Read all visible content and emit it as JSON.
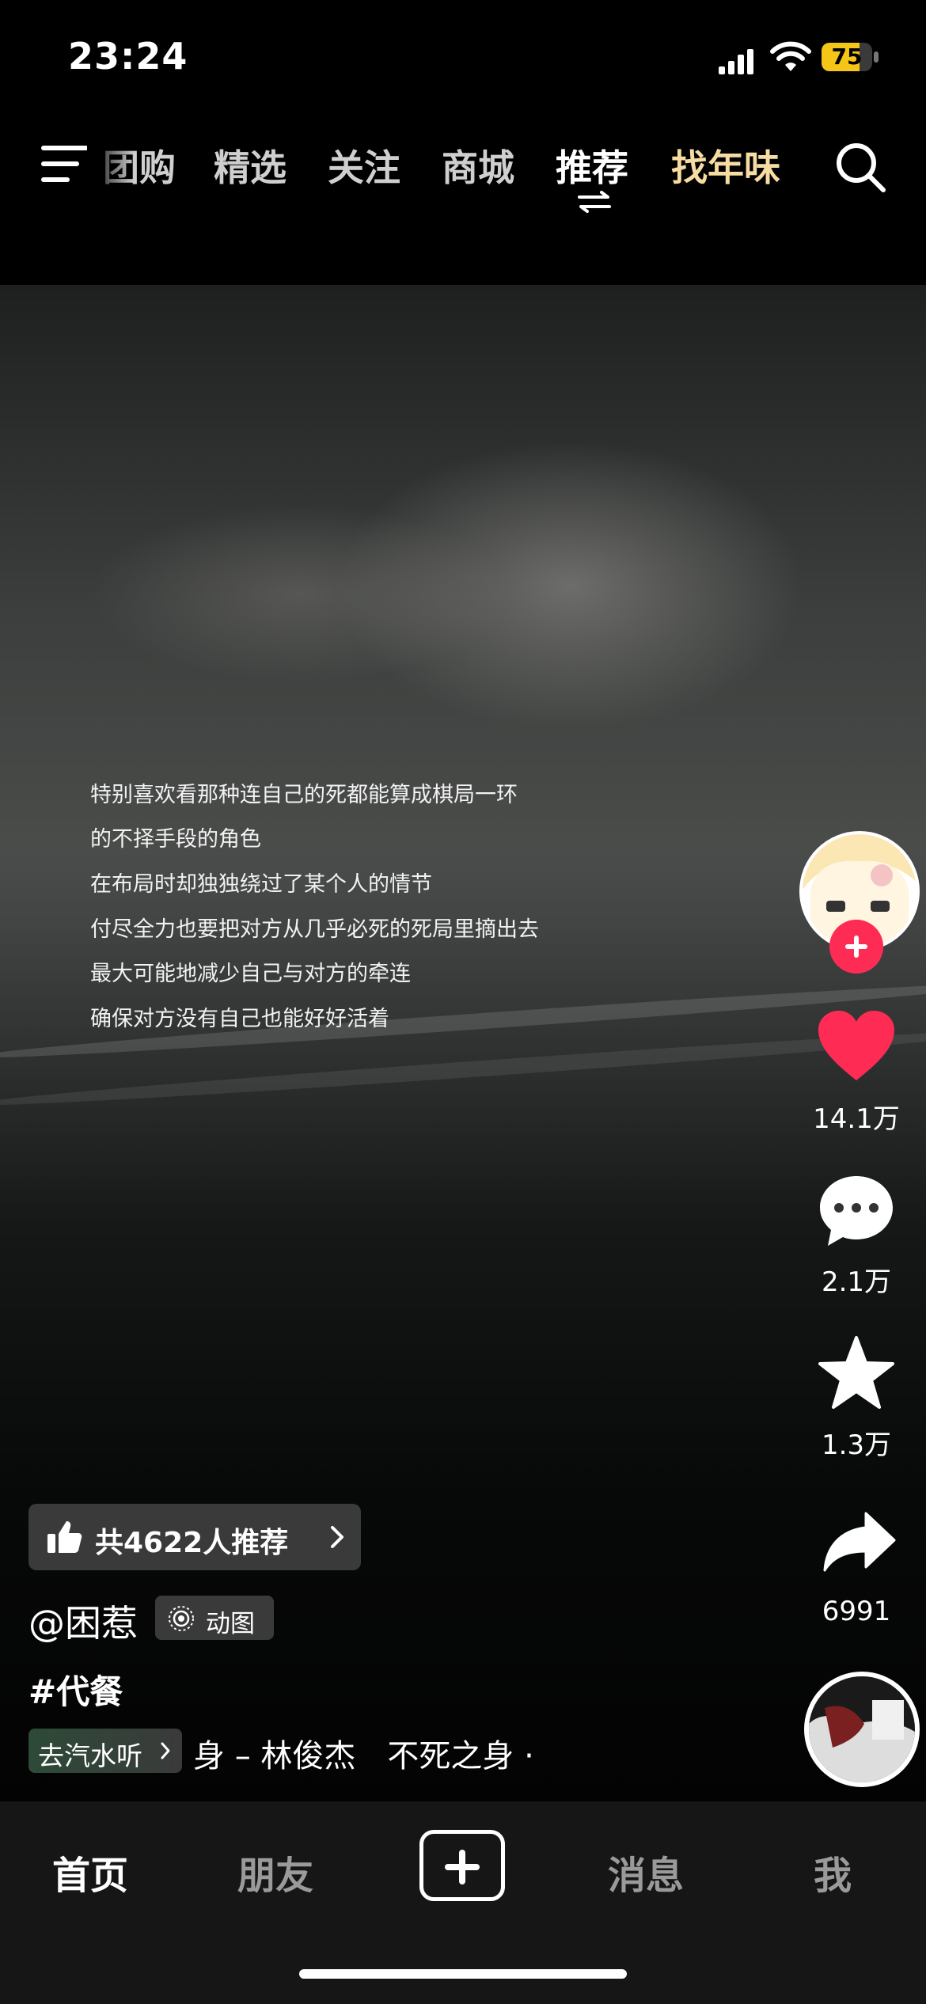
{
  "status_bar": {
    "time": "23:24",
    "battery_level": "75",
    "battery_fraction": 0.75
  },
  "top_nav": {
    "tabs": [
      {
        "label": "团购"
      },
      {
        "label": "精选"
      },
      {
        "label": "关注"
      },
      {
        "label": "商城"
      },
      {
        "label": "推荐"
      },
      {
        "label": "找年味"
      }
    ],
    "active_tab": "推荐"
  },
  "video": {
    "lyrics": [
      "特别喜欢看那种连自己的死都能算成棋局一环",
      "的不择手段的角色",
      "在布局时却独独绕过了某个人的情节",
      "付尽全力也要把对方从几乎必死的死局里摘出去",
      "最大可能地减少自己与对方的牵连",
      "确保对方没有自己也能好好活着"
    ]
  },
  "actions": {
    "likes": "14.1万",
    "comments": "2.1万",
    "favorites": "1.3万",
    "shares": "6991"
  },
  "info": {
    "recommend": "共4622人推荐",
    "author": "@困惹",
    "badge": "动图",
    "hashtag": "#代餐",
    "music_chip": "去汽水听",
    "music_title": "身 – 林俊杰　不死之身 ·"
  },
  "bottom_nav": {
    "home": "首页",
    "friends": "朋友",
    "messages": "消息",
    "me": "我"
  },
  "colors": {
    "accent": "#fe2c55",
    "special_tab": "#f6dca3",
    "battery": "#f5c518"
  }
}
